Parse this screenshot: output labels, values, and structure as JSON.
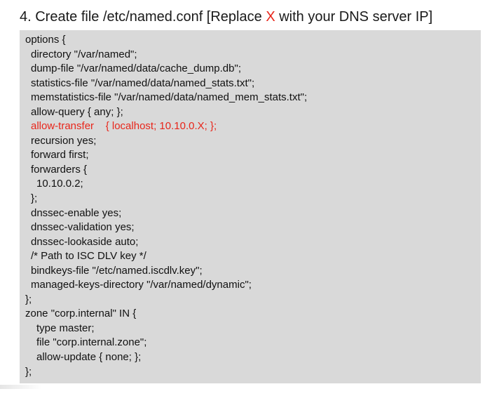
{
  "heading": {
    "prefix": "4. Create file /etc/named.conf [Replace ",
    "highlight": "X",
    "suffix": " with your DNS server IP]"
  },
  "code_lines": [
    {
      "text": "options {",
      "indent": 0,
      "highlight": false
    },
    {
      "text": "directory \"/var/named\";",
      "indent": 1,
      "highlight": false
    },
    {
      "text": "dump-file \"/var/named/data/cache_dump.db\";",
      "indent": 1,
      "highlight": false
    },
    {
      "text": "statistics-file \"/var/named/data/named_stats.txt\";",
      "indent": 1,
      "highlight": false
    },
    {
      "text": "memstatistics-file \"/var/named/data/named_mem_stats.txt\";",
      "indent": 1,
      "highlight": false
    },
    {
      "text": "allow-query { any; };",
      "indent": 1,
      "highlight": false
    },
    {
      "text": "allow-transfer    { localhost; 10.10.0.X; };",
      "indent": 1,
      "highlight": true
    },
    {
      "text": "recursion yes;",
      "indent": 1,
      "highlight": false
    },
    {
      "text": "forward first;",
      "indent": 1,
      "highlight": false
    },
    {
      "text": "forwarders {",
      "indent": 1,
      "highlight": false
    },
    {
      "text": "10.10.0.2;",
      "indent": 2,
      "highlight": false
    },
    {
      "text": "};",
      "indent": 1,
      "highlight": false
    },
    {
      "text": "dnssec-enable yes;",
      "indent": 1,
      "highlight": false
    },
    {
      "text": "dnssec-validation yes;",
      "indent": 1,
      "highlight": false
    },
    {
      "text": "dnssec-lookaside auto;",
      "indent": 1,
      "highlight": false
    },
    {
      "text": "/* Path to ISC DLV key */",
      "indent": 1,
      "highlight": false
    },
    {
      "text": "bindkeys-file \"/etc/named.iscdlv.key\";",
      "indent": 1,
      "highlight": false
    },
    {
      "text": "managed-keys-directory \"/var/named/dynamic\";",
      "indent": 1,
      "highlight": false
    },
    {
      "text": "};",
      "indent": 0,
      "highlight": false
    },
    {
      "text": "zone \"corp.internal\" IN {",
      "indent": 0,
      "highlight": false
    },
    {
      "text": "type master;",
      "indent": 2,
      "highlight": false
    },
    {
      "text": "file \"corp.internal.zone\";",
      "indent": 2,
      "highlight": false
    },
    {
      "text": "allow-update { none; };",
      "indent": 2,
      "highlight": false
    },
    {
      "text": "};",
      "indent": 0,
      "highlight": false
    }
  ],
  "colors": {
    "highlight": "#e8261b",
    "text": "#111111",
    "code_background": "#d9d9d9"
  }
}
